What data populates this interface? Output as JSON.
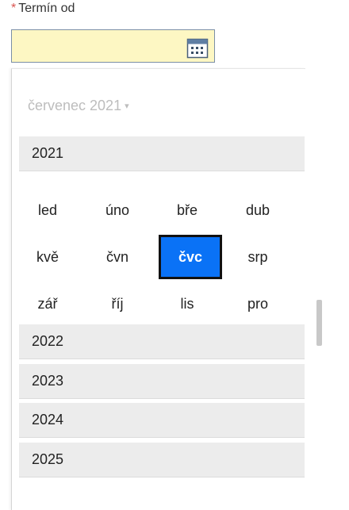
{
  "field": {
    "required_mark": "*",
    "label": "Termín od",
    "value": "",
    "calendar_icon": "calendar-icon"
  },
  "picker": {
    "header": "červenec 2021",
    "header_caret": "▾",
    "current_year": "2021",
    "months": [
      "led",
      "úno",
      "bře",
      "dub",
      "kvě",
      "čvn",
      "čvc",
      "srp",
      "zář",
      "říj",
      "lis",
      "pro"
    ],
    "selected_month": "čvc",
    "other_years": [
      "2022",
      "2023",
      "2024",
      "2025"
    ]
  },
  "colors": {
    "input_bg": "#fdf7c3",
    "selected_bg": "#0a72f6",
    "year_row_bg": "#ececec",
    "required": "#d9534f"
  }
}
